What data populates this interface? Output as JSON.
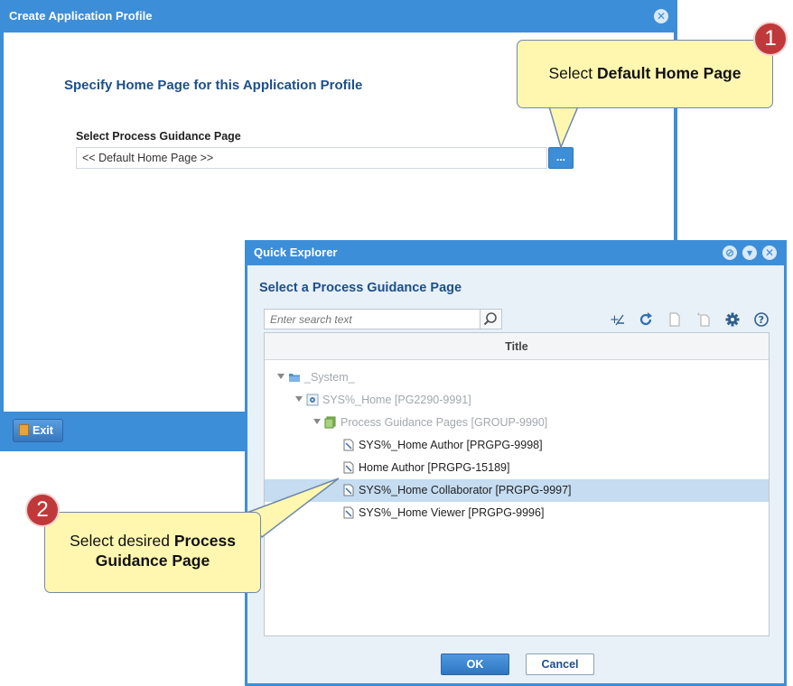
{
  "profile_window": {
    "title": "Create Application Profile",
    "heading": "Specify Home Page for this Application Profile",
    "field_label": "Select Process Guidance Page",
    "field_value": "<< Default Home Page >>",
    "browse_label": "...",
    "exit_label": "Exit"
  },
  "explorer": {
    "title": "Quick Explorer",
    "heading": "Select a Process Guidance Page",
    "search_placeholder": "Enter search text",
    "column_title": "Title",
    "tree": [
      {
        "label": "_System_",
        "level": 0,
        "dim": true,
        "type": "folder"
      },
      {
        "label": "SYS%_Home [PG2290-9991]",
        "level": 1,
        "dim": true,
        "type": "gear"
      },
      {
        "label": "Process Guidance Pages [GROUP-9990]",
        "level": 2,
        "dim": true,
        "type": "group"
      },
      {
        "label": "SYS%_Home Author [PRGPG-9998]",
        "level": 3,
        "dim": false,
        "type": "page"
      },
      {
        "label": "Home Author [PRGPG-15189]",
        "level": 3,
        "dim": false,
        "type": "page"
      },
      {
        "label": "SYS%_Home Collaborator [PRGPG-9997]",
        "level": 3,
        "dim": false,
        "type": "page",
        "selected": true
      },
      {
        "label": "SYS%_Home Viewer [PRGPG-9996]",
        "level": 3,
        "dim": false,
        "type": "page"
      }
    ],
    "ok_label": "OK",
    "cancel_label": "Cancel"
  },
  "callouts": {
    "one": {
      "number": "1",
      "text": "Select ",
      "bold": "Default Home Page"
    },
    "two": {
      "number": "2",
      "text": "Select desired ",
      "bold1": "Process",
      "bold2": "Guidance Page"
    }
  },
  "colors": {
    "accent": "#3d8ed8",
    "selected_row": "#c5dcf1",
    "callout_bg": "#fff7b0",
    "badge": "#c0393a"
  }
}
